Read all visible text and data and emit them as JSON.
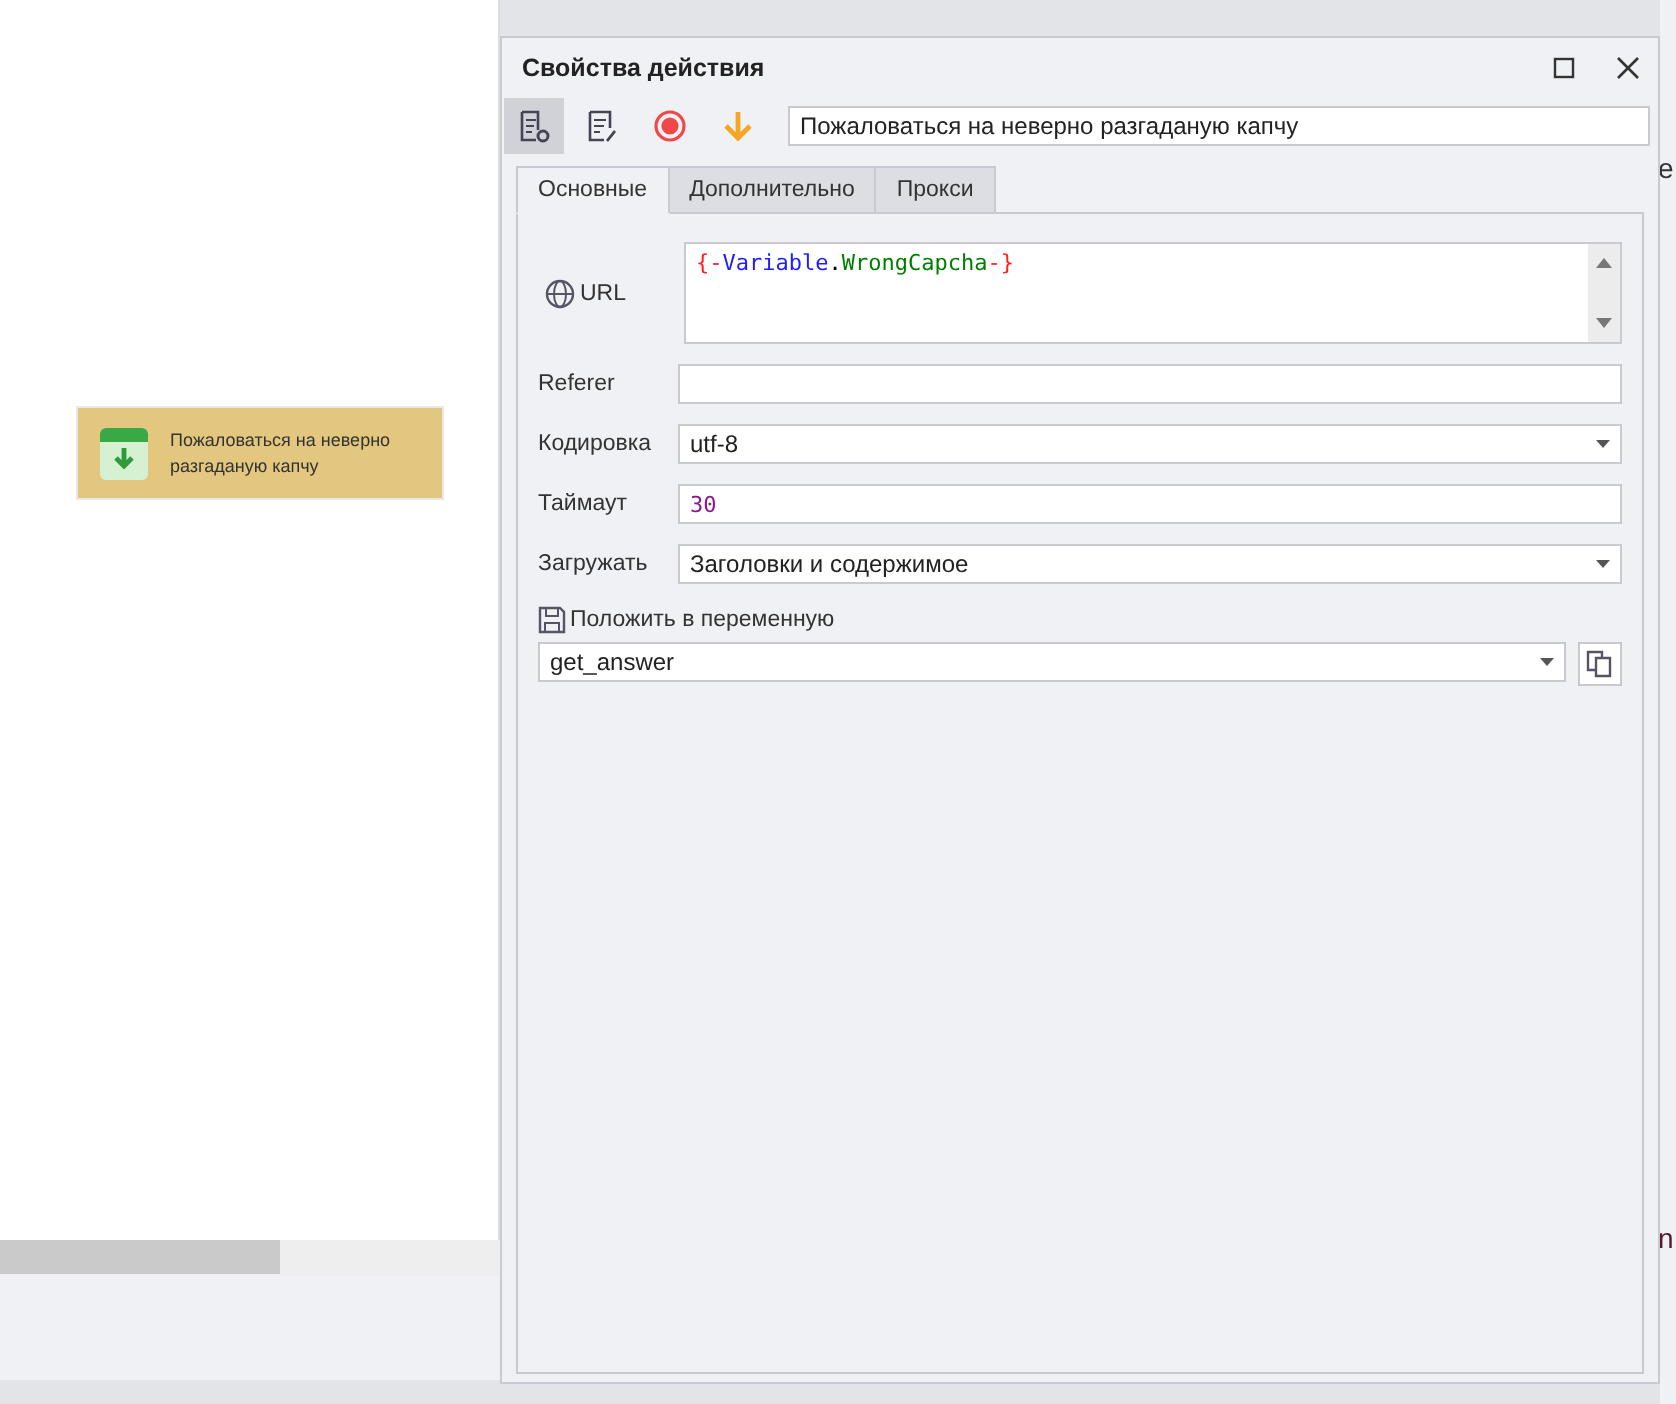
{
  "canvas": {
    "block": {
      "label": "Пожаловаться на неверно разгаданую капчу"
    }
  },
  "dialog": {
    "title": "Свойства действия",
    "toolbar": [
      {
        "kind": "settings",
        "selected": true
      },
      {
        "kind": "edit",
        "selected": false
      },
      {
        "kind": "record",
        "selected": false
      },
      {
        "kind": "arrow",
        "selected": false
      }
    ],
    "name_field": {
      "value": "Пожаловаться на неверно разгаданую капчу"
    },
    "tabs": [
      {
        "label": "Основные",
        "selected": true
      },
      {
        "label": "Дополнительно",
        "selected": false
      },
      {
        "label": "Прокси",
        "selected": false
      }
    ],
    "fields": [
      {
        "kind": "textarea",
        "label": "URL",
        "tokens": [
          {
            "text": "{-",
            "color": "#ff2020"
          },
          {
            "text": "Variable",
            "color": "#2020ff"
          },
          {
            "text": ".",
            "color": "#000000"
          },
          {
            "text": "WrongCapcha",
            "color": "#008000"
          },
          {
            "text": "-}",
            "color": "#ff2020"
          }
        ]
      },
      {
        "kind": "text",
        "label": "Referer"
      },
      {
        "kind": "combo",
        "label": "Кодировка",
        "value": "utf-8"
      },
      {
        "kind": "number",
        "label": "Таймаут",
        "value": "30"
      },
      {
        "kind": "combo",
        "label": "Загружать",
        "value": "Заголовки и содержимое"
      }
    ],
    "variable": {
      "label": "Положить в переменную",
      "value": "get_answer"
    }
  },
  "edge_texts": [
    "e",
    "n"
  ]
}
